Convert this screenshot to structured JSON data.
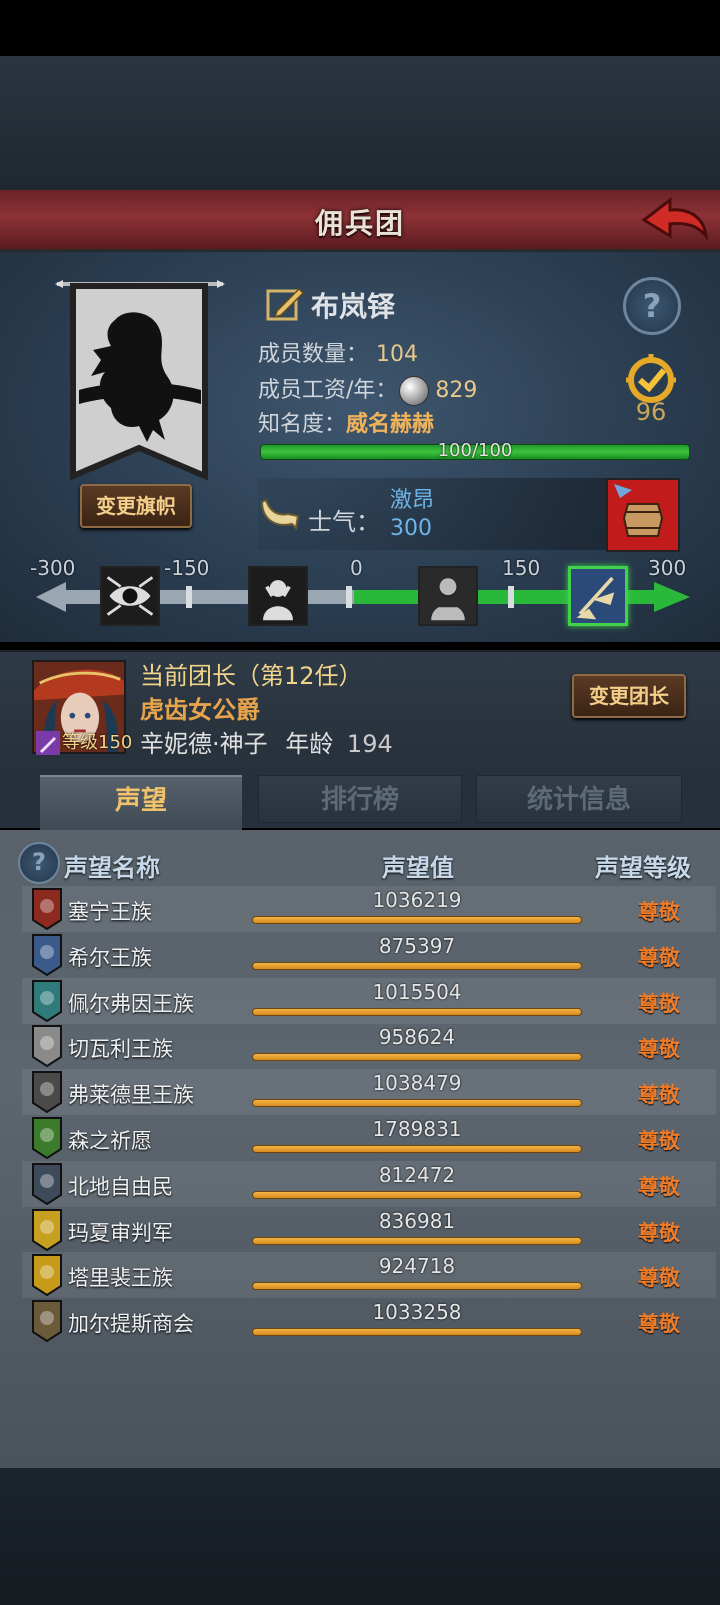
{
  "title": "佣兵团",
  "guild": {
    "name": "布岚铎",
    "member_label": "成员数量：",
    "member_count": "104",
    "wage_label": "成员工资/年：",
    "wage_value": "829",
    "fame_label": "知名度：",
    "fame_word": "威名赫赫",
    "fame_progress_text": "100/100",
    "fame_progress": 1.0,
    "rank_value": "96",
    "change_banner_label": "变更旗帜"
  },
  "morale": {
    "label": "士气：",
    "state": "激昂",
    "value": "300",
    "scale_labels": [
      "-300",
      "-150",
      "0",
      "150",
      "300"
    ],
    "current": 300
  },
  "leader": {
    "line1": "当前团长（第12任）",
    "title": "虎齿女公爵",
    "name": "辛妮德·神子",
    "age_label": "年龄",
    "age": "194",
    "level_label": "等级",
    "level": "150",
    "change_leader_label": "变更团长"
  },
  "tabs": [
    {
      "label": "声望",
      "active": true
    },
    {
      "label": "排行榜",
      "active": false
    },
    {
      "label": "统计信息",
      "active": false
    }
  ],
  "reputation": {
    "headers": {
      "name": "声望名称",
      "value": "声望值",
      "level": "声望等级"
    },
    "rows": [
      {
        "name": "塞宁王族",
        "value": "1036219",
        "level": "尊敬",
        "icon": "red-shield-icon",
        "color": "#8c2a20"
      },
      {
        "name": "希尔王族",
        "value": "875397",
        "level": "尊敬",
        "icon": "blue-crest-icon",
        "color": "#3a5a8a"
      },
      {
        "name": "佩尔弗因王族",
        "value": "1015504",
        "level": "尊敬",
        "icon": "teal-moon-icon",
        "color": "#2f7a7a"
      },
      {
        "name": "切瓦利王族",
        "value": "958624",
        "level": "尊敬",
        "icon": "scales-icon",
        "color": "#8a8a8a"
      },
      {
        "name": "弗莱德里王族",
        "value": "1038479",
        "level": "尊敬",
        "icon": "dark-mask-icon",
        "color": "#4a4a4a"
      },
      {
        "name": "森之祈愿",
        "value": "1789831",
        "level": "尊敬",
        "icon": "tree-icon",
        "color": "#3c7a2c"
      },
      {
        "name": "北地自由民",
        "value": "812472",
        "level": "尊敬",
        "icon": "wolf-icon",
        "color": "#3c4a5a"
      },
      {
        "name": "玛夏审判军",
        "value": "836981",
        "level": "尊敬",
        "icon": "gold-cross-icon",
        "color": "#c8a020"
      },
      {
        "name": "塔里裴王族",
        "value": "924718",
        "level": "尊敬",
        "icon": "gold-crown-icon",
        "color": "#c89a1a"
      },
      {
        "name": "加尔提斯商会",
        "value": "1033258",
        "level": "尊敬",
        "icon": "chest-icon",
        "color": "#6a5a3a"
      }
    ]
  }
}
